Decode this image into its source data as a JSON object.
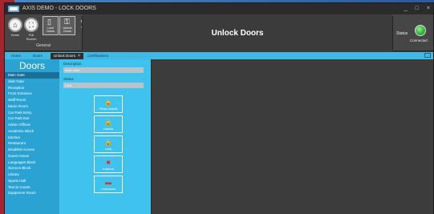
{
  "window": {
    "title": "AXIS DEMO - LOCK DOORS",
    "controls": [
      "_",
      "□",
      "×"
    ]
  },
  "ribbon": {
    "buttons": [
      {
        "label": "Home"
      },
      {
        "label": "Full Screen"
      }
    ],
    "tiles": [
      {
        "label": "Lock Doors"
      },
      {
        "label": "Unlock Doors"
      },
      {
        "label": "Help"
      }
    ],
    "group_label": "General",
    "page_title": "Unlock Doors",
    "status": {
      "label": "Status",
      "value": "Connected",
      "color": "#1fa22a"
    }
  },
  "tabs": [
    {
      "label": "Home"
    },
    {
      "label": "Doors"
    },
    {
      "label": "Unlock Doors",
      "closable": true
    },
    {
      "label": "Certifications"
    }
  ],
  "sidebar": {
    "title": "Doors",
    "items": [
      "Main Gate",
      "Side Gate",
      "Reception",
      "Front Entrance",
      "Staff Room",
      "Music Room",
      "Car Park Entry",
      "Car Park Exit",
      "Admin Offices",
      "Academic Block",
      "Kitchen",
      "Restaurant",
      "Disabled Access",
      "Guest House",
      "Languages Block",
      "Science Block",
      "Library",
      "Sports Hall",
      "Tennis Courts",
      "Equipment Room"
    ],
    "selected_index": 0
  },
  "detail": {
    "description_label": "Description",
    "description_value": "Main Gate",
    "status_label": "Status",
    "status_value": "Lock",
    "actions": [
      {
        "label": "Temp Unlock",
        "icon": "unlock-timer-icon"
      },
      {
        "label": "Unlock",
        "icon": "unlock-icon"
      },
      {
        "label": "Lock",
        "icon": "lock-icon"
      },
      {
        "label": "Lockout",
        "icon": "lockout-icon"
      },
      {
        "label": "Lockdown",
        "icon": "lockdown-icon"
      }
    ]
  },
  "colors": {
    "accent": "#3fb9e3",
    "sidebar": "#2aa3d3",
    "panel": "#3fc3ee",
    "selected": "#1b6f99"
  }
}
